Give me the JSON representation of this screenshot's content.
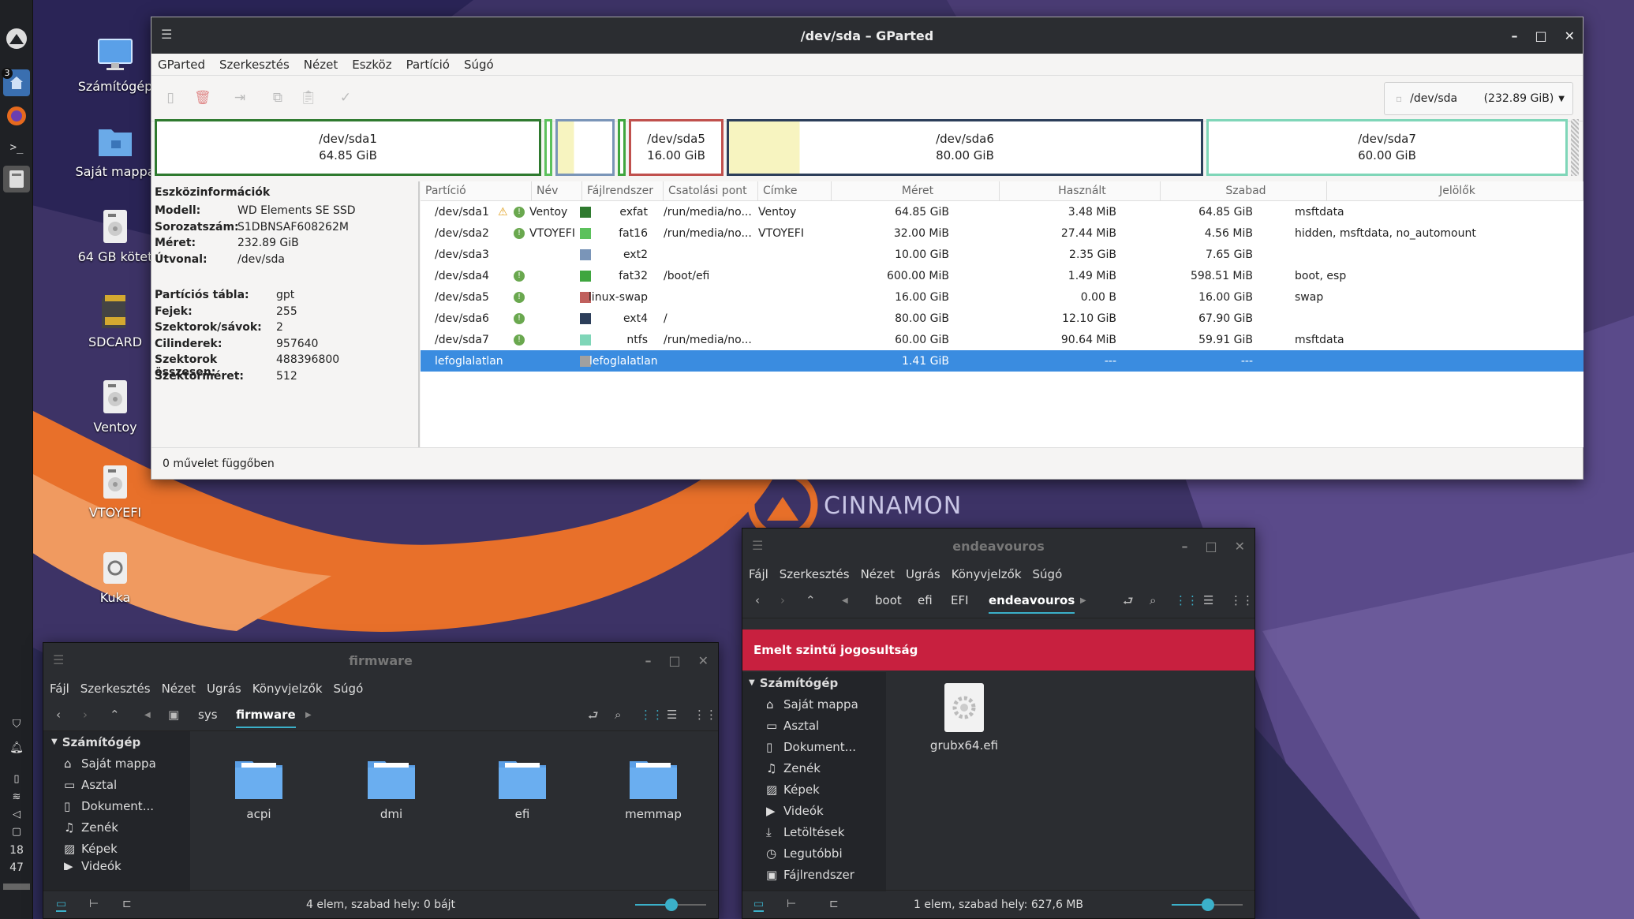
{
  "panel": {
    "workspace_badge": "3",
    "clock_hours": "18",
    "clock_minutes": "47"
  },
  "desktop": {
    "icons": [
      {
        "label": "Számítógép",
        "icon": "computer-icon"
      },
      {
        "label": "Saját mappa",
        "icon": "home-folder-icon"
      },
      {
        "label": "64 GB kötet",
        "icon": "drive-icon"
      },
      {
        "label": "SDCARD",
        "icon": "sdcard-icon"
      },
      {
        "label": "Ventoy",
        "icon": "drive-icon"
      },
      {
        "label": "VTOYEFI",
        "icon": "drive-icon"
      },
      {
        "label": "Kuka",
        "icon": "trash-icon"
      }
    ],
    "wallpaper_text": "CINNAMON"
  },
  "gparted": {
    "title": "/dev/sda – GParted",
    "menu": [
      "GParted",
      "Szerkesztés",
      "Nézet",
      "Eszköz",
      "Partíció",
      "Súgó"
    ],
    "device_selector": {
      "device": "/dev/sda",
      "size": "(232.89 GiB)"
    },
    "map": [
      {
        "name": "/dev/sda1",
        "size": "64.85 GiB",
        "color": "#2f7a2f"
      },
      {
        "name": "/dev/sda5",
        "size": "16.00 GiB",
        "color": "#c0504d"
      },
      {
        "name": "/dev/sda6",
        "size": "80.00 GiB",
        "color": "#2c3e5a"
      },
      {
        "name": "/dev/sda7",
        "size": "60.00 GiB",
        "color": "#7fd6b8"
      }
    ],
    "device_info": {
      "heading": "Eszközinformációk",
      "rows1": [
        {
          "k": "Modell:",
          "v": "WD Elements SE SSD"
        },
        {
          "k": "Sorozatszám:",
          "v": "S1DBNSAF608262M"
        },
        {
          "k": "Méret:",
          "v": "232.89 GiB"
        },
        {
          "k": "Útvonal:",
          "v": "/dev/sda"
        }
      ],
      "rows2": [
        {
          "k": "Partíciós tábla:",
          "v": "gpt"
        },
        {
          "k": "Fejek:",
          "v": "255"
        },
        {
          "k": "Szektorok/sávok:",
          "v": "2"
        },
        {
          "k": "Cilinderek:",
          "v": "957640"
        },
        {
          "k": "Szektorok összesen:",
          "v": "488396800"
        },
        {
          "k": "Szektorméret:",
          "v": "512"
        }
      ]
    },
    "columns": [
      "Partíció",
      "Név",
      "Fájlrendszer",
      "Csatolási pont",
      "Címke",
      "Méret",
      "Használt",
      "Szabad",
      "Jelölők"
    ],
    "rows": [
      {
        "part": "/dev/sda1",
        "name": "Ventoy",
        "fs": "exfat",
        "fscolor": "#2f7a2f",
        "mount": "/run/media/no...",
        "label": "Ventoy",
        "size": "64.85 GiB",
        "used": "3.48 MiB",
        "free": "64.85 GiB",
        "flags": "msftdata",
        "warn": true,
        "info": true
      },
      {
        "part": "/dev/sda2",
        "name": "VTOYEFI",
        "fs": "fat16",
        "fscolor": "#5cc15c",
        "mount": "/run/media/no...",
        "label": "VTOYEFI",
        "size": "32.00 MiB",
        "used": "27.44 MiB",
        "free": "4.56 MiB",
        "flags": "hidden, msftdata, no_automount",
        "warn": false,
        "info": true
      },
      {
        "part": "/dev/sda3",
        "name": "",
        "fs": "ext2",
        "fscolor": "#7a95b8",
        "mount": "",
        "label": "",
        "size": "10.00 GiB",
        "used": "2.35 GiB",
        "free": "7.65 GiB",
        "flags": "",
        "warn": false,
        "info": false
      },
      {
        "part": "/dev/sda4",
        "name": "",
        "fs": "fat32",
        "fscolor": "#3fa63f",
        "mount": "/boot/efi",
        "label": "",
        "size": "600.00 MiB",
        "used": "1.49 MiB",
        "free": "598.51 MiB",
        "flags": "boot, esp",
        "warn": false,
        "info": true
      },
      {
        "part": "/dev/sda5",
        "name": "",
        "fs": "linux-swap",
        "fscolor": "#c0605d",
        "mount": "",
        "label": "",
        "size": "16.00 GiB",
        "used": "0.00 B",
        "free": "16.00 GiB",
        "flags": "swap",
        "warn": false,
        "info": true
      },
      {
        "part": "/dev/sda6",
        "name": "",
        "fs": "ext4",
        "fscolor": "#2c3e5a",
        "mount": "/",
        "label": "",
        "size": "80.00 GiB",
        "used": "12.10 GiB",
        "free": "67.90 GiB",
        "flags": "",
        "warn": false,
        "info": true
      },
      {
        "part": "/dev/sda7",
        "name": "",
        "fs": "ntfs",
        "fscolor": "#7fd6b8",
        "mount": "/run/media/no...",
        "label": "",
        "size": "60.00 GiB",
        "used": "90.64 MiB",
        "free": "59.91 GiB",
        "flags": "msftdata",
        "warn": false,
        "info": true
      },
      {
        "part": "lefoglalatlan",
        "name": "",
        "fs": "lefoglalatlan",
        "fscolor": "#a0a0a0",
        "mount": "",
        "label": "",
        "size": "1.41 GiB",
        "used": "---",
        "free": "---",
        "flags": "",
        "warn": false,
        "info": false,
        "selected": true
      }
    ],
    "status": "0 művelet függőben"
  },
  "fm_firmware": {
    "title": "firmware",
    "menu": [
      "Fájl",
      "Szerkesztés",
      "Nézet",
      "Ugrás",
      "Könyvjelzők",
      "Súgó"
    ],
    "crumbs": [
      "sys",
      "firmware"
    ],
    "sidebar_header": "Számítógép",
    "sidebar": [
      "Saját mappa",
      "Asztal",
      "Dokument...",
      "Zenék",
      "Képek",
      "Videók"
    ],
    "files": [
      "acpi",
      "dmi",
      "efi",
      "memmap"
    ],
    "status": "4 elem, szabad hely: 0 bájt"
  },
  "fm_endeavouros": {
    "title": "endeavouros",
    "menu": [
      "Fájl",
      "Szerkesztés",
      "Nézet",
      "Ugrás",
      "Könyvjelzők",
      "Súgó"
    ],
    "crumbs": [
      "boot",
      "efi",
      "EFI",
      "endeavouros"
    ],
    "banner": "Emelt szintű jogosultság",
    "banner_color": "#c8203f",
    "sidebar_header": "Számítógép",
    "sidebar": [
      "Saját mappa",
      "Asztal",
      "Dokument...",
      "Zenék",
      "Képek",
      "Videók",
      "Letöltések",
      "Legutóbbi",
      "Fájlrendszer"
    ],
    "files": [
      "grubx64.efi"
    ],
    "status": "1 elem, szabad hely: 627,6 MB"
  }
}
